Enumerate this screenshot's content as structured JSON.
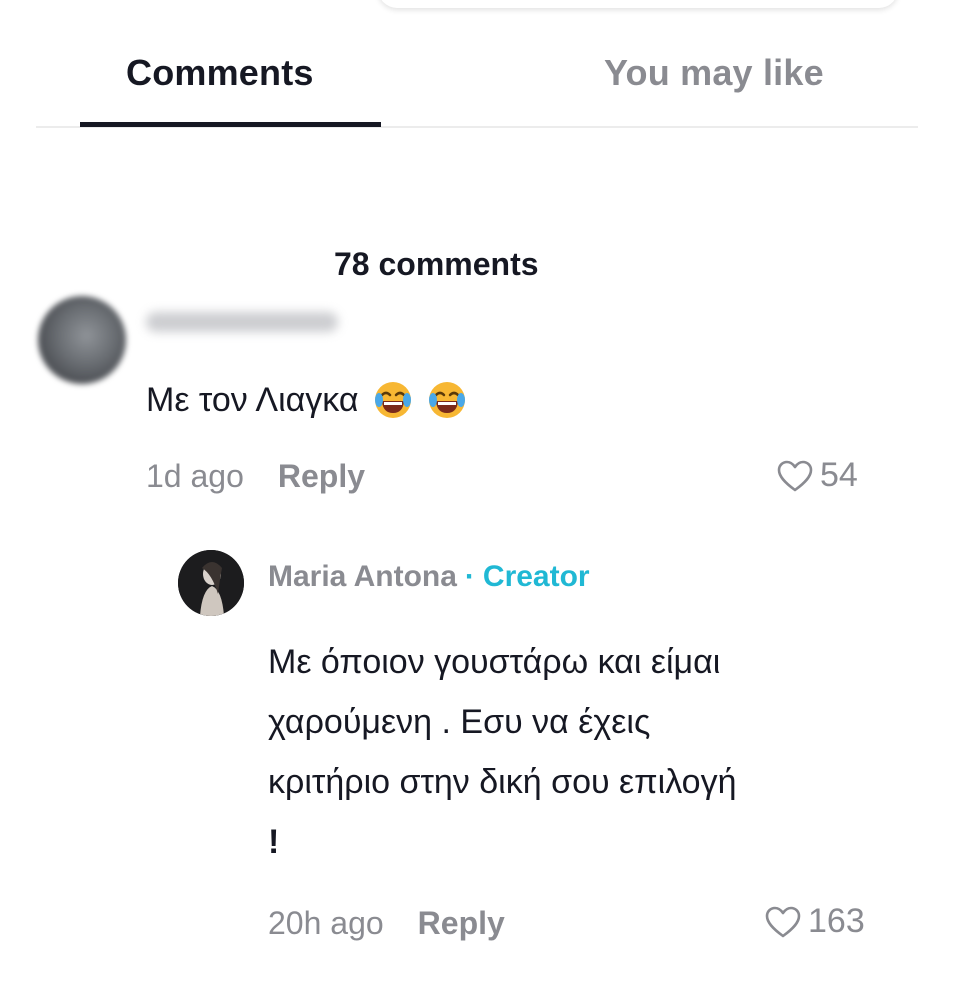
{
  "tabs": {
    "comments": "Comments",
    "you_may_like": "You may like"
  },
  "comment_count": "78 comments",
  "comments": [
    {
      "text": "Με τον Λιαγκα",
      "emoji": [
        "tears-of-joy-emoji",
        "tears-of-joy-emoji"
      ],
      "time": "1d ago",
      "reply_label": "Reply",
      "likes": "54"
    }
  ],
  "reply": {
    "author": "Maria Antona",
    "separator": "·",
    "badge": "Creator",
    "lines": [
      "Με όποιον γουστάρω και είμαι",
      "χαρούμενη . Εσυ να έχεις",
      "κριτήριο στην δική σου επιλογή",
      "!"
    ],
    "time": "20h ago",
    "reply_label": "Reply",
    "likes": "163"
  },
  "colors": {
    "text": "#161823",
    "muted": "#8a8b91",
    "creator": "#20b8d4"
  }
}
